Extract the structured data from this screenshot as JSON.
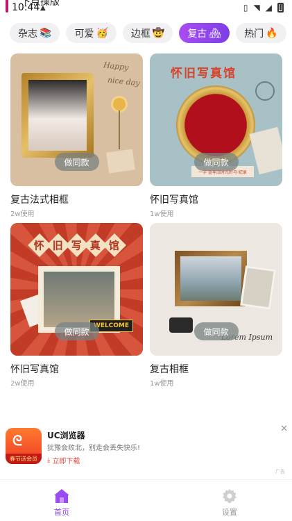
{
  "status_bar": {
    "time": "10:44",
    "overlay_text": "下点操版",
    "icons": [
      "vibrate-icon",
      "wifi-icon",
      "signal-icon",
      "battery-icon"
    ]
  },
  "tabs": [
    {
      "label": "杂志",
      "emoji": "📚",
      "active": false
    },
    {
      "label": "可爱",
      "emoji": "🥳",
      "active": false
    },
    {
      "label": "边框",
      "emoji": "🤠",
      "active": false
    },
    {
      "label": "复古",
      "emoji": "🏘",
      "active": true
    },
    {
      "label": "热门",
      "emoji": "🔥",
      "active": false
    }
  ],
  "cards": [
    {
      "title": "复古法式相框",
      "usage": "2w使用",
      "button": "做同款",
      "art_text": [
        "Happy",
        "nice day"
      ]
    },
    {
      "title": "怀旧写真馆",
      "usage": "1w使用",
      "button": "做同款",
      "art_text": [
        "怀旧写真馆",
        "一字·宣年旧时光好马·纪录"
      ]
    },
    {
      "title": "怀旧写真馆",
      "usage": "2w使用",
      "button": "做同款",
      "art_text": [
        "怀",
        "旧",
        "写",
        "真",
        "馆",
        "WELCOME"
      ]
    },
    {
      "title": "复古相框",
      "usage": "1w使用",
      "button": "做同款",
      "art_text": [
        "Lorem Ipsum"
      ]
    }
  ],
  "ad": {
    "app_name": "UC浏览器",
    "subtitle": "犹豫会败北，别走会丢失快乐!",
    "download_label": "立即下载",
    "logo_ribbon": "春节送会员",
    "tag": "广告"
  },
  "bottom_nav": [
    {
      "label": "首页",
      "icon": "home-icon",
      "active": true
    },
    {
      "label": "设置",
      "icon": "gear-icon",
      "active": false
    }
  ],
  "colors": {
    "accent": "#8b3fe6",
    "tab_bg": "#f1f1f3",
    "ad_download": "#e0443a"
  }
}
